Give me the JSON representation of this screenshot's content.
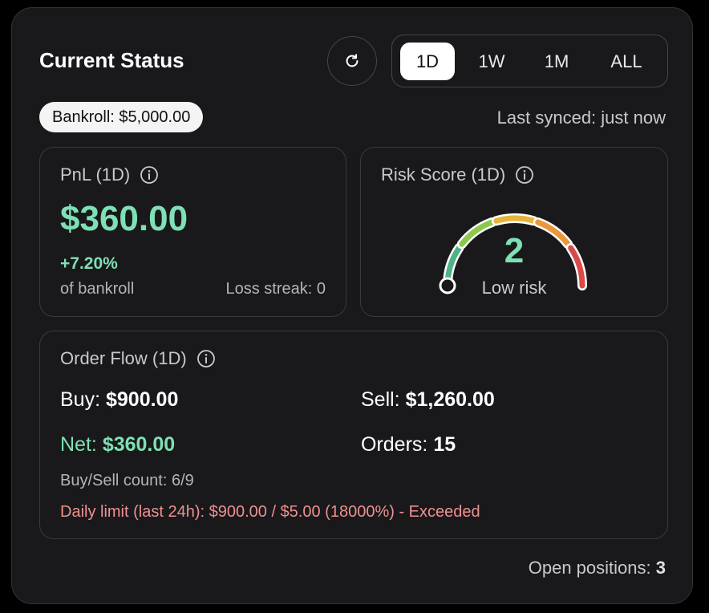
{
  "header": {
    "title": "Current Status",
    "refresh_icon": "refresh-icon",
    "ranges": [
      {
        "label": "1D",
        "active": true
      },
      {
        "label": "1W",
        "active": false
      },
      {
        "label": "1M",
        "active": false
      },
      {
        "label": "ALL",
        "active": false
      }
    ]
  },
  "bankroll": {
    "label": "Bankroll: $5,000.00",
    "synced": "Last synced: just now"
  },
  "pnl": {
    "title": "PnL (1D)",
    "info_icon": "info-icon",
    "value": "$360.00",
    "percent": "+7.20%",
    "sub": "of bankroll",
    "loss_streak": "Loss streak: 0"
  },
  "risk": {
    "title": "Risk Score (1D)",
    "info_icon": "info-icon",
    "score": "2",
    "level": 0.2,
    "label": "Low risk",
    "colors": [
      "#4fb286",
      "#8cc94a",
      "#e6b43c",
      "#e8973a",
      "#d9494a"
    ]
  },
  "order_flow": {
    "title": "Order Flow (1D)",
    "info_icon": "info-icon",
    "buy_label": "Buy:",
    "buy_value": "$900.00",
    "sell_label": "Sell:",
    "sell_value": "$1,260.00",
    "net_label": "Net:",
    "net_value": "$360.00",
    "orders_label": "Orders:",
    "orders_value": "15",
    "count": "Buy/Sell count: 6/9",
    "daily_limit": "Daily limit (last 24h): $900.00 / $5.00 (18000%) - Exceeded"
  },
  "footer": {
    "open_positions_label": "Open positions:",
    "open_positions_value": "3"
  },
  "colors": {
    "accent_green": "#7ee0b4",
    "warning_red": "#f0908f",
    "card_bg": "#19191b"
  }
}
